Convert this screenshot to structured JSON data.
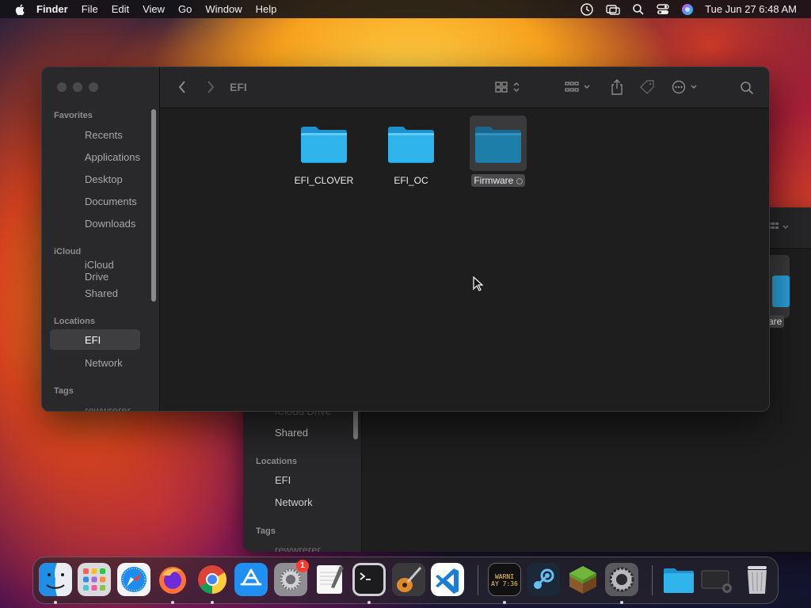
{
  "menubar": {
    "app_name": "Finder",
    "items": [
      "File",
      "Edit",
      "View",
      "Go",
      "Window",
      "Help"
    ],
    "clock": "Tue Jun 27  6:48 AM",
    "status_icons": [
      "screen-time-icon",
      "screen-mirroring-icon",
      "search-icon",
      "control-center-icon",
      "siri-icon"
    ]
  },
  "finder": {
    "title": "EFI",
    "sidebar": {
      "favorites_heading": "Favorites",
      "favorites": [
        "Recents",
        "Applications",
        "Desktop",
        "Documents",
        "Downloads"
      ],
      "icloud_heading": "iCloud",
      "icloud": [
        "iCloud Drive",
        "Shared"
      ],
      "locations_heading": "Locations",
      "locations": [
        "EFI",
        "Network"
      ],
      "tags_heading": "Tags",
      "tags": [
        "rewwrerer"
      ],
      "selected": "EFI"
    },
    "items": [
      {
        "name": "EFI_CLOVER",
        "selected": false
      },
      {
        "name": "EFI_OC",
        "selected": false
      },
      {
        "name": "Firmware",
        "selected": true
      }
    ],
    "folder_color": "#2fb5ec"
  },
  "back_window": {
    "sidebar": {
      "icloud": [
        "iCloud Drive",
        "Shared"
      ],
      "locations_heading": "Locations",
      "locations": [
        "EFI",
        "Network"
      ],
      "tags_heading": "Tags",
      "tags": [
        "rewwrerer"
      ]
    },
    "partial_label": "are"
  },
  "dock": {
    "apps": [
      "Finder",
      "Launchpad",
      "Safari",
      "Firefox",
      "Google Chrome",
      "App Store",
      "System Settings",
      "TextEdit",
      "Terminal",
      "GarageBand",
      "Visual Studio Code",
      "Minecraft Launcher Log",
      "Steam",
      "Minecraft",
      "System Preferences",
      "Folder",
      "Screenshot",
      "Trash"
    ],
    "system_settings_badge": "1",
    "mini_log_text": [
      "WARNI",
      "AY 7:36"
    ]
  }
}
